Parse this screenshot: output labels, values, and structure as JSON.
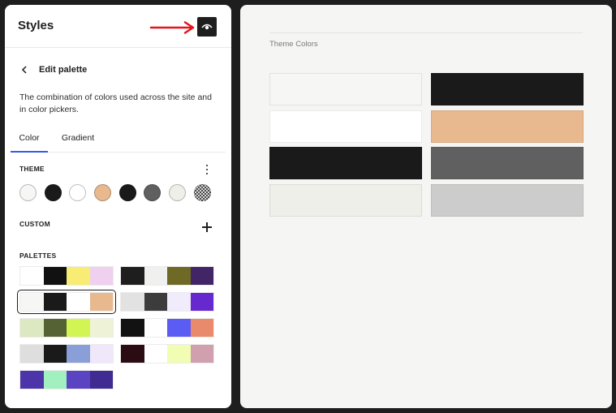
{
  "sidebar": {
    "title": "Styles",
    "preview_icon": "eye-icon",
    "back_label": "Edit palette",
    "description": "The combination of colors used across the site and in color pickers.",
    "tabs": [
      {
        "label": "Color",
        "active": true
      },
      {
        "label": "Gradient",
        "active": false
      }
    ],
    "theme_label": "THEME",
    "theme_colors": [
      "#f6f6f4",
      "#1a1a1a",
      "#ffffff",
      "#e8b88e",
      "#1a1a1a",
      "#606060",
      "#efefea",
      "pattern"
    ],
    "custom_label": "CUSTOM",
    "palettes_label": "PALETTES",
    "palettes": [
      [
        "#ffffff",
        "#111111",
        "#f8ec74",
        "#efd1ef"
      ],
      [
        "#1e1e1e",
        "#f0f0ef",
        "#6e6a25",
        "#412567"
      ],
      [
        "#f6f6f4",
        "#1a1a1a",
        "#ffffff",
        "#e8b88e"
      ],
      [
        "#e2e2e2",
        "#3c3c3c",
        "#f1ecfb",
        "#6629d0"
      ],
      [
        "#dbe8c2",
        "#556234",
        "#d2f553",
        "#eef3d8"
      ],
      [
        "#121212",
        "#ffffff",
        "#5b5cf3",
        "#ea8a6c"
      ],
      [
        "#dedede",
        "#1a1a1a",
        "#8a9ed8",
        "#f1e7fb"
      ],
      [
        "#2a0c12",
        "#ffffff",
        "#f1fdb3",
        "#d0a0ae"
      ],
      [
        "#4b35a8",
        "#a2f0c0",
        "#5a44c2",
        "#3f2b91"
      ]
    ],
    "selected_palette": 2
  },
  "canvas": {
    "title": "Theme Colors",
    "swatches": [
      "#f6f6f4",
      "#1a1a1a",
      "#ffffff",
      "#e8b88e",
      "#1a1a1a",
      "#606060",
      "#efefea",
      "#cccccc"
    ]
  },
  "colors": {
    "accent": "#3858e9",
    "annotation_arrow": "#e3141b"
  }
}
